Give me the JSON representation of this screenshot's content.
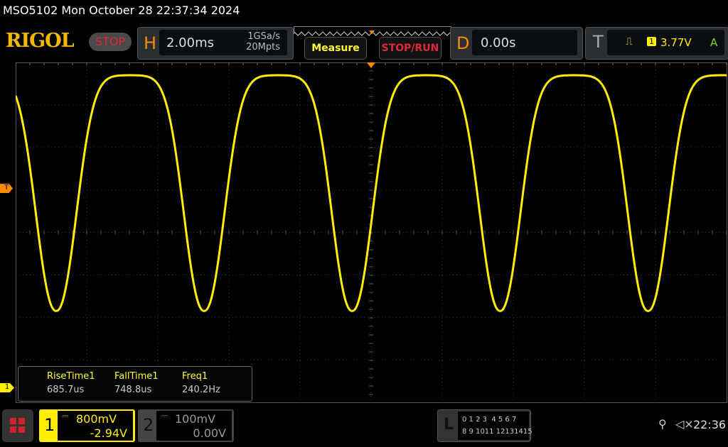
{
  "title": "MSO5102  Mon October 28 22:37:34 2024",
  "logo": "RIGOL",
  "run_state": "STOP",
  "horizontal": {
    "letter": "H",
    "timebase": "2.00ms",
    "sample_rate": "1GSa/s",
    "memory": "20Mpts"
  },
  "buttons": {
    "measure": "Measure",
    "stop_run": "STOP/RUN"
  },
  "delay": {
    "letter": "D",
    "value": "0.00s"
  },
  "trigger": {
    "letter": "T",
    "source": "1",
    "level": "3.77V",
    "mode": "A",
    "marker": "T"
  },
  "measurements": [
    {
      "label": "RiseTime1",
      "value": "685.7us"
    },
    {
      "label": "FallTime1",
      "value": "748.8us"
    },
    {
      "label": "Freq1",
      "value": "240.2Hz"
    }
  ],
  "channel1": {
    "num": "1",
    "scale": "800mV",
    "offset": "-2.94V",
    "marker": "1",
    "color": "#ffee00"
  },
  "channel2": {
    "num": "2",
    "scale": "100mV",
    "offset": "0.00V"
  },
  "logic": {
    "letter": "L",
    "row1": "0 1 2 3  4 5 6 7",
    "row2": "8 9 1011 12131415"
  },
  "status": {
    "clock": "22:36",
    "usb_icon": "usb-icon",
    "sound_icon": "mute-icon"
  },
  "waveform": {
    "period_ms": 4.163,
    "time_per_div_ms": 2.0,
    "high_div": 3.7,
    "low_div": -1.85
  }
}
